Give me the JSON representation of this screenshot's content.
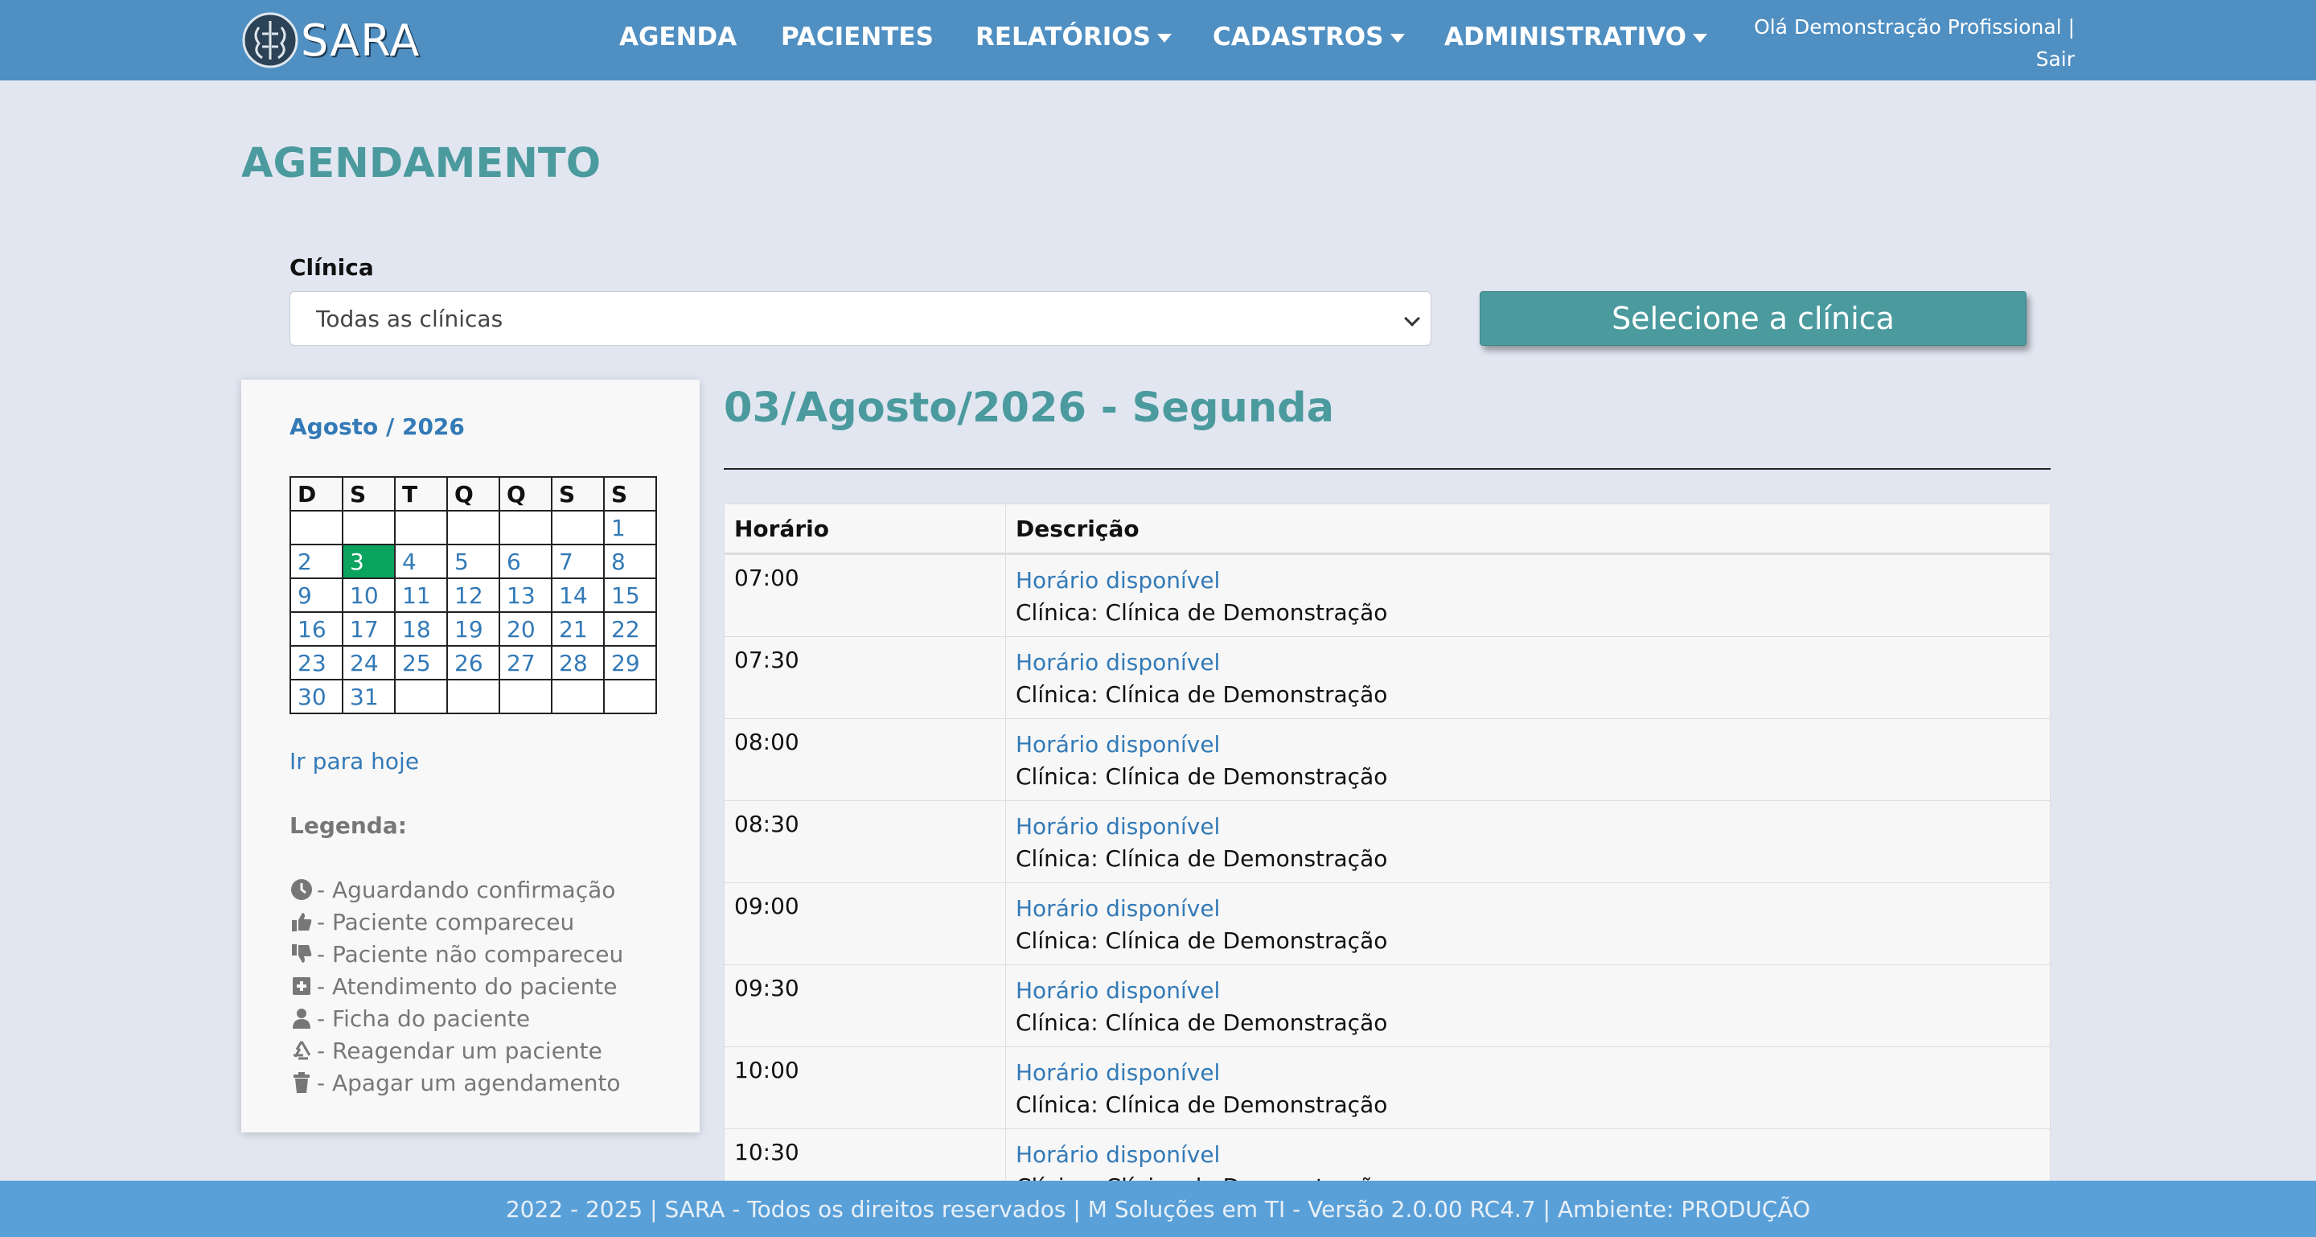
{
  "nav": {
    "brand": "SARA",
    "items": [
      {
        "label": "AGENDA",
        "dropdown": false
      },
      {
        "label": "PACIENTES",
        "dropdown": false
      },
      {
        "label": "RELATÓRIOS",
        "dropdown": true
      },
      {
        "label": "CADASTROS",
        "dropdown": true
      },
      {
        "label": "ADMINISTRATIVO",
        "dropdown": true
      }
    ],
    "greeting": "Olá Demonstração Profissional |",
    "logout": "Sair"
  },
  "page": {
    "title": "AGENDAMENTO",
    "clinic_label": "Clínica",
    "clinic_selected": "Todas as clínicas",
    "clinic_button": "Selecione a clínica"
  },
  "calendar": {
    "month": "Agosto / 2026",
    "weekdays": [
      "D",
      "S",
      "T",
      "Q",
      "Q",
      "S",
      "S"
    ],
    "weeks": [
      [
        "",
        "",
        "",
        "",
        "",
        "",
        "1"
      ],
      [
        "2",
        "3",
        "4",
        "5",
        "6",
        "7",
        "8"
      ],
      [
        "9",
        "10",
        "11",
        "12",
        "13",
        "14",
        "15"
      ],
      [
        "16",
        "17",
        "18",
        "19",
        "20",
        "21",
        "22"
      ],
      [
        "23",
        "24",
        "25",
        "26",
        "27",
        "28",
        "29"
      ],
      [
        "30",
        "31",
        "",
        "",
        "",
        "",
        ""
      ]
    ],
    "selected_day": "3",
    "goto_today": "Ir para hoje"
  },
  "legend": {
    "title": "Legenda:",
    "items": [
      {
        "icon": "clock-icon",
        "label": "- Aguardando confirmação"
      },
      {
        "icon": "thumbs-up-icon",
        "label": "- Paciente compareceu"
      },
      {
        "icon": "thumbs-down-icon",
        "label": "- Paciente não compareceu"
      },
      {
        "icon": "medical-kit-icon",
        "label": "- Atendimento do paciente"
      },
      {
        "icon": "user-icon",
        "label": "- Ficha do paciente"
      },
      {
        "icon": "recycle-icon",
        "label": "- Reagendar um paciente"
      },
      {
        "icon": "trash-icon",
        "label": "- Apagar um agendamento"
      }
    ]
  },
  "schedule": {
    "day_title": "03/Agosto/2026 - Segunda",
    "headers": {
      "time": "Horário",
      "description": "Descrição"
    },
    "rows": [
      {
        "time": "07:00",
        "status": "Horário disponível",
        "clinic": "Clínica: Clínica de Demonstração"
      },
      {
        "time": "07:30",
        "status": "Horário disponível",
        "clinic": "Clínica: Clínica de Demonstração"
      },
      {
        "time": "08:00",
        "status": "Horário disponível",
        "clinic": "Clínica: Clínica de Demonstração"
      },
      {
        "time": "08:30",
        "status": "Horário disponível",
        "clinic": "Clínica: Clínica de Demonstração"
      },
      {
        "time": "09:00",
        "status": "Horário disponível",
        "clinic": "Clínica: Clínica de Demonstração"
      },
      {
        "time": "09:30",
        "status": "Horário disponível",
        "clinic": "Clínica: Clínica de Demonstração"
      },
      {
        "time": "10:00",
        "status": "Horário disponível",
        "clinic": "Clínica: Clínica de Demonstração"
      },
      {
        "time": "10:30",
        "status": "Horário disponível",
        "clinic": "Clínica: Clínica de Demonstração"
      }
    ]
  },
  "footer": {
    "text": "2022 - 2025 | SARA - Todos os direitos reservados | M Soluções em TI - Versão 2.0.00 RC4.7 | Ambiente: PRODUÇÃO"
  },
  "colors": {
    "navbar": "#4f8fc2",
    "accent": "#4a9a9e",
    "link": "#337ab7",
    "today": "#0ba360",
    "footer": "#5aa0d8"
  }
}
